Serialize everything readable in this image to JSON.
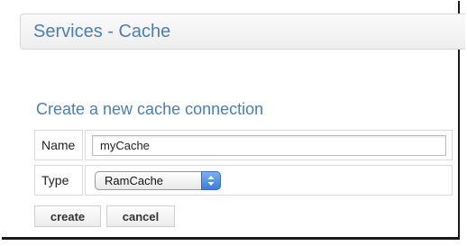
{
  "header": {
    "title": "Services - Cache"
  },
  "form": {
    "title": "Create a new cache connection",
    "name_label": "Name",
    "name_value": "myCache",
    "type_label": "Type",
    "type_value": "RamCache"
  },
  "buttons": {
    "create": "create",
    "cancel": "cancel"
  },
  "colors": {
    "heading": "#4a7fb5",
    "select_accent": "#3a7be0"
  },
  "icons": {
    "select_arrows": "up-down-arrows-icon"
  }
}
